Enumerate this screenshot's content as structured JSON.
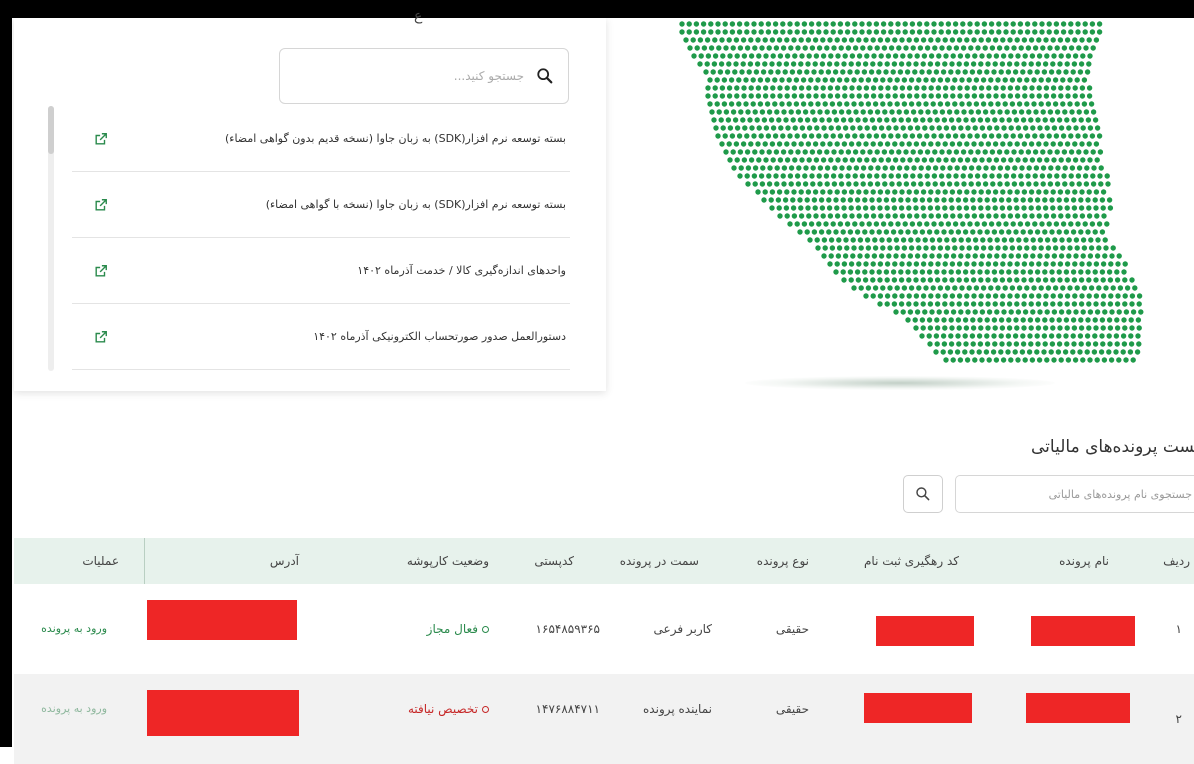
{
  "documents": {
    "heading_fragment": "ع",
    "search_placeholder": "جستجو کنید...",
    "items": [
      {
        "label": "بسته توسعه نرم افزار(SDK) به زبان جاوا (نسخه قدیم بدون گواهی امضاء)"
      },
      {
        "label": "بسته توسعه نرم افزار(SDK) به زبان جاوا (نسخه با گواهی امضاء)"
      },
      {
        "label": "واحدهای اندازه‌گیری کالا / خدمت آذرماه ۱۴۰۲"
      },
      {
        "label": "دستورالعمل صدور صورتحساب الکترونیکی آذرماه ۱۴۰۲"
      }
    ]
  },
  "tax_files": {
    "title": "لیست پرونده‌های مالیاتی",
    "search_placeholder": "جستجوی نام پرونده‌های مالیاتی",
    "columns": {
      "row": "ردیف",
      "file_name": "نام پرونده",
      "tracking": "کد رهگیری ثبت نام",
      "file_type": "نوع پرونده",
      "role": "سمت در پرونده",
      "postal": "کدپستی",
      "status": "وضعیت کارپوشه",
      "address": "آدرس",
      "actions": "عملیات"
    },
    "rows": [
      {
        "row": "۱",
        "file_type": "حقیقی",
        "role": "کاربر فرعی",
        "postal": "۱۶۵۴۸۵۹۳۶۵",
        "status": "فعال مجاز",
        "action": "ورود به پرونده"
      },
      {
        "row": "۲",
        "file_type": "حقیقی",
        "role": "نماینده پرونده",
        "postal": "۱۴۷۶۸۸۴۷۱۱",
        "status": "تخصیص نیافته",
        "action": "ورود به پرونده"
      }
    ]
  },
  "colors": {
    "accent": "#2a8a4c",
    "map_dot": "#1f9a4a",
    "header_bg": "#e7f2ec",
    "error": "#c62828",
    "redaction": "#ee2626"
  }
}
